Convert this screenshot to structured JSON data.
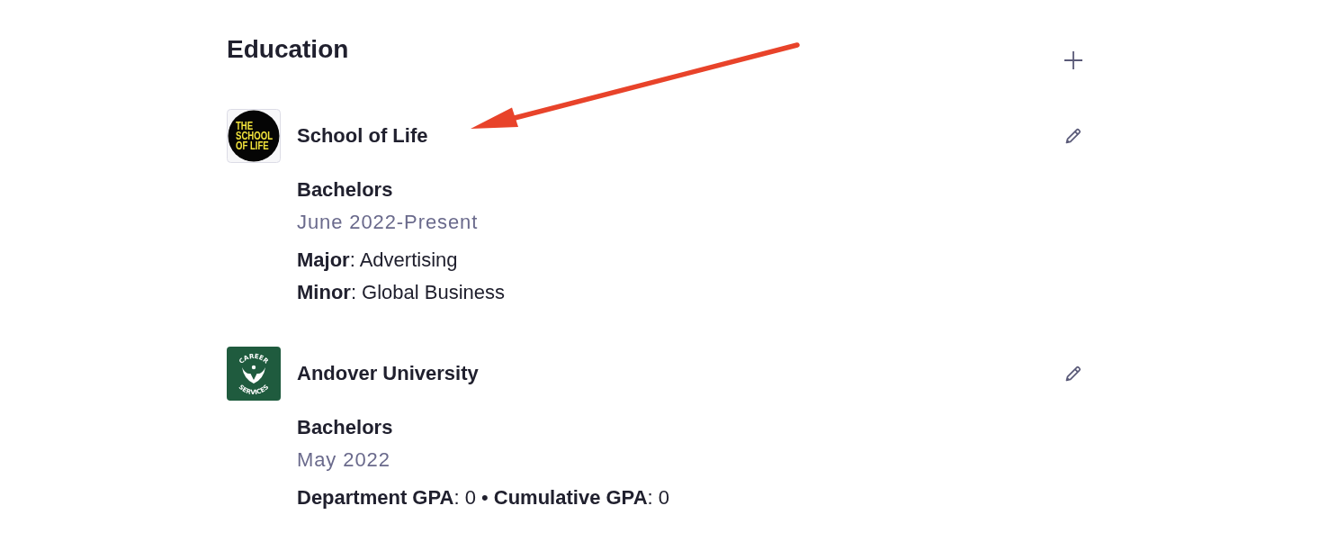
{
  "section": {
    "title": "Education"
  },
  "entries": [
    {
      "school": "School of Life",
      "logo": {
        "kind": "circle-badge",
        "lines": [
          "THE",
          "SCHOOL",
          "OF LIFE"
        ]
      },
      "degree": "Bachelors",
      "dates": "June 2022-Present",
      "details": [
        "**Major**: Advertising",
        "**Minor**: Global Business"
      ]
    },
    {
      "school": "Andover University",
      "logo": {
        "kind": "bird-seal",
        "top": "CAREER",
        "bottom": "SERVICES"
      },
      "degree": "Bachelors",
      "dates": "May 2022",
      "details": [
        "**Department GPA**: 0 • **Cumulative GPA**: 0"
      ]
    }
  ],
  "annotations": [
    {
      "kind": "arrow"
    }
  ]
}
